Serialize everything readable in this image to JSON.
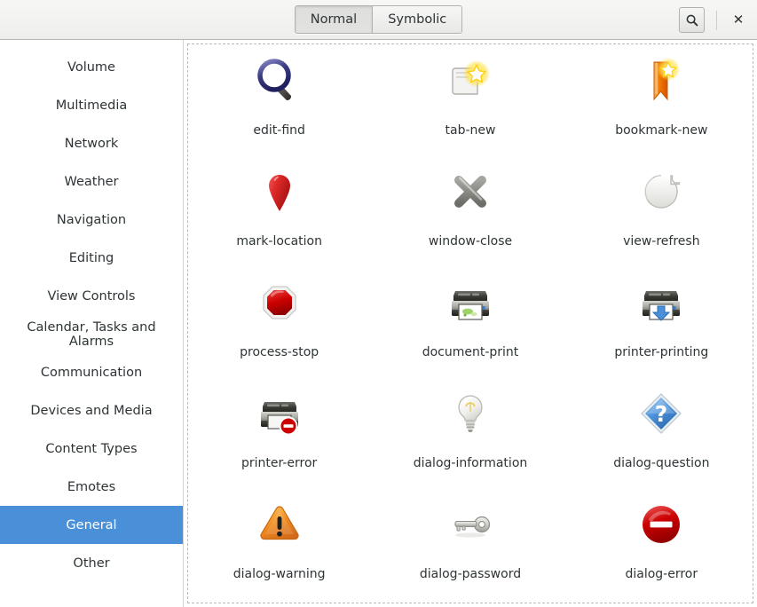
{
  "header": {
    "modes": [
      {
        "label": "Normal",
        "selected": true
      },
      {
        "label": "Symbolic",
        "selected": false
      }
    ],
    "search_icon": "search-icon",
    "close_label": "✕"
  },
  "sidebar": {
    "items": [
      {
        "label": "Volume",
        "selected": false
      },
      {
        "label": "Multimedia",
        "selected": false
      },
      {
        "label": "Network",
        "selected": false
      },
      {
        "label": "Weather",
        "selected": false
      },
      {
        "label": "Navigation",
        "selected": false
      },
      {
        "label": "Editing",
        "selected": false
      },
      {
        "label": "View Controls",
        "selected": false
      },
      {
        "label": "Calendar, Tasks and Alarms",
        "selected": false
      },
      {
        "label": "Communication",
        "selected": false
      },
      {
        "label": "Devices and Media",
        "selected": false
      },
      {
        "label": "Content Types",
        "selected": false
      },
      {
        "label": "Emotes",
        "selected": false
      },
      {
        "label": "General",
        "selected": true
      },
      {
        "label": "Other",
        "selected": false
      }
    ],
    "selection_color": "#4a90d9"
  },
  "main": {
    "icons": [
      {
        "label": "edit-find",
        "art": "magnifier"
      },
      {
        "label": "tab-new",
        "art": "tab-star"
      },
      {
        "label": "bookmark-new",
        "art": "ribbon-star"
      },
      {
        "label": "mark-location",
        "art": "map-pin"
      },
      {
        "label": "window-close",
        "art": "x-mark"
      },
      {
        "label": "view-refresh",
        "art": "refresh-arrow"
      },
      {
        "label": "process-stop",
        "art": "stop-octagon"
      },
      {
        "label": "document-print",
        "art": "printer-doc"
      },
      {
        "label": "printer-printing",
        "art": "printer-download"
      },
      {
        "label": "printer-error",
        "art": "printer-error-badge"
      },
      {
        "label": "dialog-information",
        "art": "light-bulb"
      },
      {
        "label": "dialog-question",
        "art": "blue-diamond-question"
      },
      {
        "label": "dialog-warning",
        "art": "warning-triangle"
      },
      {
        "label": "dialog-password",
        "art": "key"
      },
      {
        "label": "dialog-error",
        "art": "red-circle-minus"
      }
    ]
  }
}
